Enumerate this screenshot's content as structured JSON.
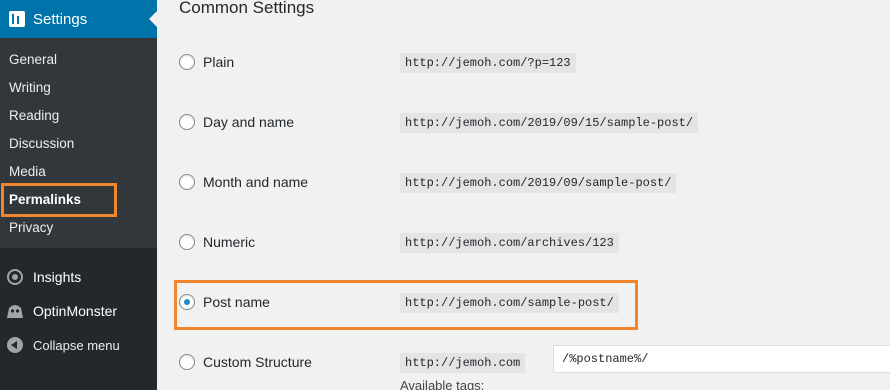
{
  "sidebar": {
    "settings_label": "Settings",
    "items": [
      {
        "label": "General"
      },
      {
        "label": "Writing"
      },
      {
        "label": "Reading"
      },
      {
        "label": "Discussion"
      },
      {
        "label": "Media"
      },
      {
        "label": "Permalinks",
        "active": true
      },
      {
        "label": "Privacy"
      }
    ],
    "insights_label": "Insights",
    "optinmonster_label": "OptinMonster",
    "collapse_label": "Collapse menu"
  },
  "main": {
    "section_title": "Common Settings",
    "options": [
      {
        "label": "Plain",
        "example": "http://jemoh.com/?p=123",
        "checked": false
      },
      {
        "label": "Day and name",
        "example": "http://jemoh.com/2019/09/15/sample-post/",
        "checked": false
      },
      {
        "label": "Month and name",
        "example": "http://jemoh.com/2019/09/sample-post/",
        "checked": false
      },
      {
        "label": "Numeric",
        "example": "http://jemoh.com/archives/123",
        "checked": false
      },
      {
        "label": "Post name",
        "example": "http://jemoh.com/sample-post/",
        "checked": true
      },
      {
        "label": "Custom Structure",
        "example": "http://jemoh.com",
        "checked": false
      }
    ],
    "custom_structure_value": "/%postname%/",
    "available_tags_partial": "Available tags:"
  },
  "colors": {
    "sidebar_bg": "#23282d",
    "submenu_bg": "#32373c",
    "accent_blue": "#0073aa",
    "highlight_orange": "#f0852d"
  }
}
